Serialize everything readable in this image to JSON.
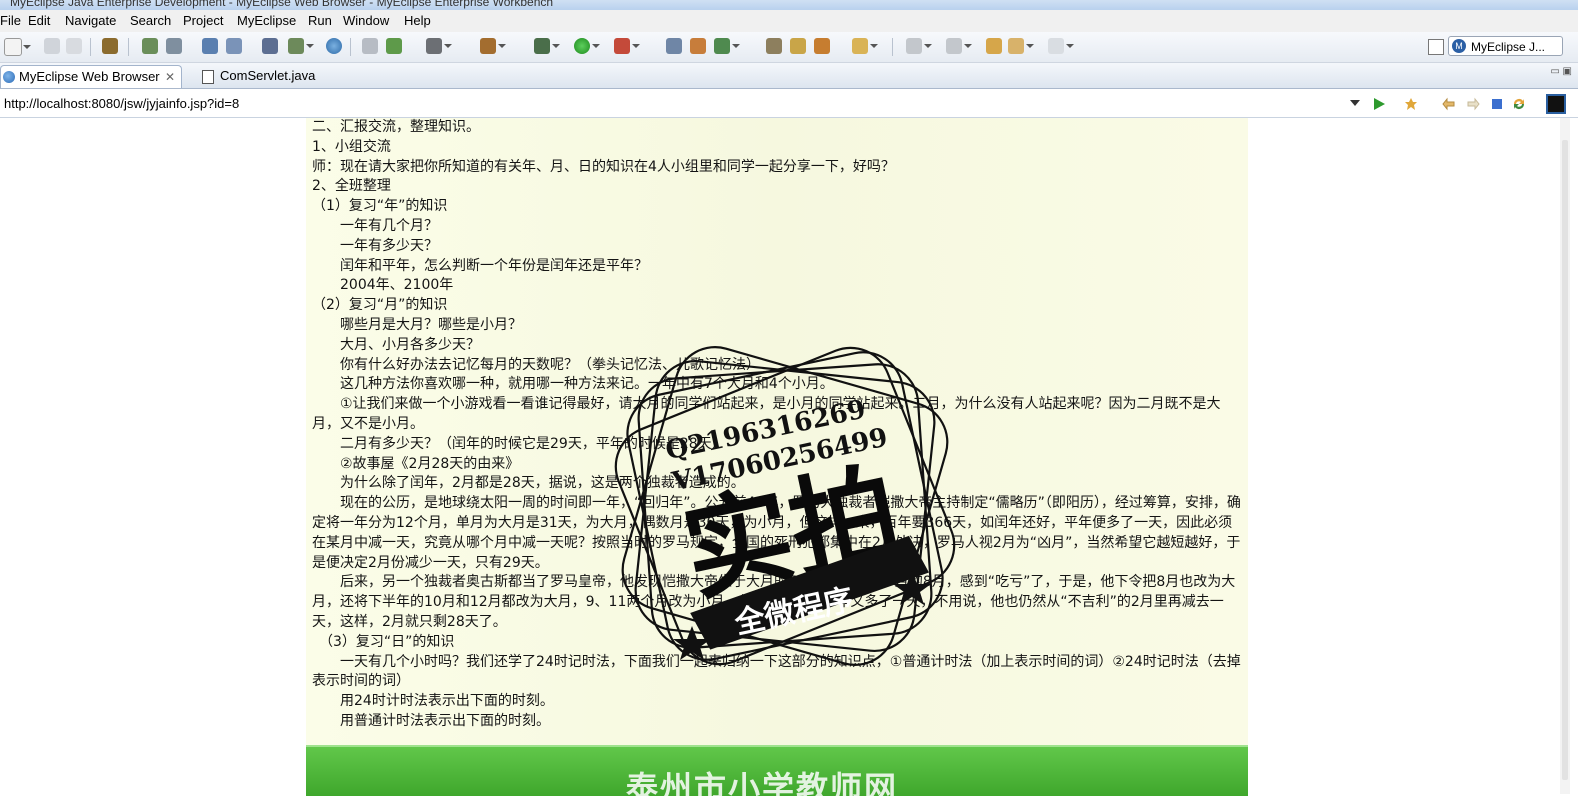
{
  "window": {
    "title": "MyEclipse Java Enterprise Development - MyEclipse Web Browser - MyEclipse Enterprise Workbench"
  },
  "menu": [
    "File",
    "Edit",
    "Navigate",
    "Search",
    "Project",
    "MyEclipse",
    "Run",
    "Window",
    "Help"
  ],
  "perspective": {
    "label": "MyEclipse J..."
  },
  "tabs": [
    {
      "label": "MyEclipse Web Browser",
      "icon": "globe-icon",
      "active": true
    },
    {
      "label": "ComServlet.java",
      "icon": "java-file-icon",
      "active": false
    }
  ],
  "browser": {
    "url": "http://localhost:8080/jsw/jyjainfo.jsp?id=8"
  },
  "page": {
    "lines": [
      "二、汇报交流，整理知识。",
      "1、小组交流",
      "师：现在请大家把你所知道的有关年、月、日的知识在4人小组里和同学一起分享一下，好吗？",
      "2、全班整理",
      "（1）复习“年”的知识",
      "　　一年有几个月？",
      "　　一年有多少天？",
      "　　闰年和平年，怎么判断一个年份是闰年还是平年？",
      "　　2004年、2100年",
      "（2）复习“月”的知识",
      "　　哪些月是大月？哪些是小月？",
      "　　大月、小月各多少天？",
      "　　你有什么好办法去记忆每月的天数呢？（拳头记忆法、儿歌记忆法）",
      "　　这几种方法你喜欢哪一种，就用哪一种方法来记。一年中有7个大月和4个小月。",
      "　　①让我们来做一个小游戏看一看谁记得最好，请大月的同学们站起来，是小月的同学站起来。二月，为什么没有人站起来呢？因为二月既不是大月，又不是小月。",
      "　　二月有多少天？（闰年的时候它是29天，平年的时候是28天）",
      "　　②故事屋《2月28天的由来》",
      "　　为什么除了闰年，2月都是28天，据说，这是两个独裁者造成的。",
      "　　现在的公历，是地球绕太阳一周的时间即一年，“回归年”。公元前46年，罗马大独裁者恺撒大帝主持制定“儒略历”（即阳历），经过筹算，安排，确定将一年分为12个月，单月为大月是31天，为大月，偶数月是30天，为小月，但这样一来，百年要366天，如闰年还好，平年便多了一天，因此必须在某月中减一天，究竟从哪个月中减一天呢？按照当时的罗马规定，全国的死刑犯都集中在2月处决，罗马人视2月为“凶月”，当然希望它越短越好，于是便决定2月份减少一天，只有29天。",
      "　　后来，另一个独裁者奥古斯都当了罗马皇帝，他发现恺撒大帝生于大月的7月，而他生于小月的8月，感到“吃亏”了，于是，他下令把8月也改为大月，还将下半年的10月和12月都改为大月，9、11两个月改为小月，但这么一改，一年又多了一天，不用说，他也仍然从“不吉利”的2月里再减去一天，这样，2月就只剩28天了。",
      "　（3）复习“日”的知识",
      "　　一天有几个小时吗？我们还学了24时记时法，下面我们一起来归纳一下这部分的知识点，①普通计时法（加上表示时间的词）②24时记时法（去掉表示时间的词）",
      "　　用24时计时法表示出下面的时刻。",
      "　　用普通计时法表示出下面的时刻。"
    ],
    "footer_banner": "泰州市小学教师网"
  },
  "watermark": {
    "qq": "Q2196316269",
    "phone": "V17060256499",
    "big_text": "实拍",
    "ribbon_text": "全微程序"
  }
}
